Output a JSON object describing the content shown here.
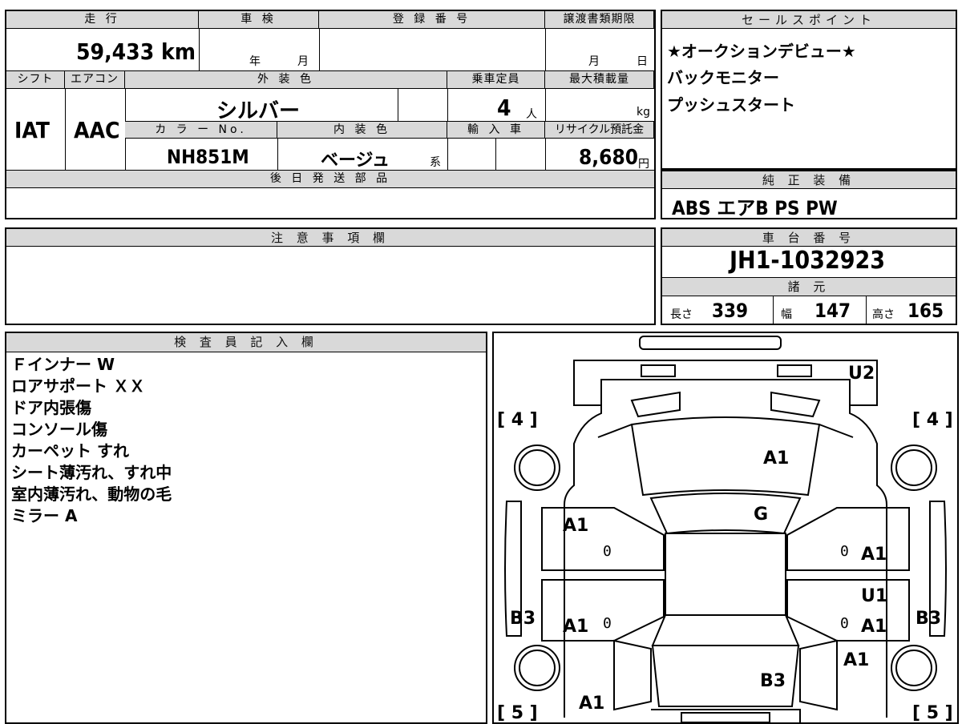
{
  "vehicle": {
    "mileage_header": "走 行",
    "mileage": "59,433 km",
    "inspection_header": "車 検",
    "inspection_year_unit": "年",
    "inspection_month_unit": "月",
    "registration_header": "登 録 番 号",
    "transfer_header": "譲渡書類期限",
    "transfer_month_unit": "月",
    "transfer_day_unit": "日",
    "shift_header": "シフト",
    "shift": "IAT",
    "ac_header": "エアコン",
    "ac": "AAC",
    "exterior_header": "外 装 色",
    "exterior_color": "シルバー",
    "capacity_header": "乗車定員",
    "capacity": "4",
    "capacity_unit": "人",
    "max_load_header": "最大積載量",
    "max_load_unit": "kg",
    "color_no_header": "カ ラ ー No.",
    "color_no": "NH851M",
    "interior_header": "内 装 色",
    "interior_color": "ベージュ",
    "interior_suffix": "系",
    "import_header": "輸 入 車",
    "recycle_header": "リサイクル預託金",
    "recycle_fee": "8,680",
    "recycle_unit": "円",
    "later_parts_header": "後 日 発 送 部 品"
  },
  "sales_points": {
    "header": "セールスポイント",
    "lines": [
      "★オークションデビュー★",
      "バックモニター",
      "プッシュスタート"
    ]
  },
  "equipment": {
    "header": "純 正 装 備",
    "value": "ABS エアB PS PW"
  },
  "caution": {
    "header": "注 意 事 項 欄"
  },
  "chassis": {
    "header": "車 台 番 号",
    "number": "JH1-1032923",
    "specs_header": "諸 元",
    "length_label": "長さ",
    "length": "339",
    "width_label": "幅",
    "width": "147",
    "height_label": "高さ",
    "height": "165"
  },
  "inspector": {
    "header": "検 査 員 記 入 欄",
    "notes": [
      "Ｆインナー W",
      "ロアサポート ＸＸ",
      "ドア内張傷",
      "コンソール傷",
      "カーペット すれ",
      "シート薄汚れ、すれ中",
      "室内薄汚れ、動物の毛",
      "ミラー A"
    ]
  },
  "diagram": {
    "tire_fl": "[ 4 ]",
    "tire_fr": "[ 4 ]",
    "tire_rl": "[ 5 ]",
    "tire_rr": "[ 5 ]",
    "marks": {
      "u2": "U2",
      "hood": "A1",
      "windshield": "G",
      "front_left_door": "A1",
      "front_right_door": "A1",
      "right_u1": "U1",
      "rear_left_door": "A1",
      "rear_right_door": "A1",
      "left_sill": "B3",
      "right_sill": "B3",
      "right_rear_fender": "A1",
      "roof_rear": "B3",
      "left_rear": "A1",
      "zero": "0"
    }
  }
}
